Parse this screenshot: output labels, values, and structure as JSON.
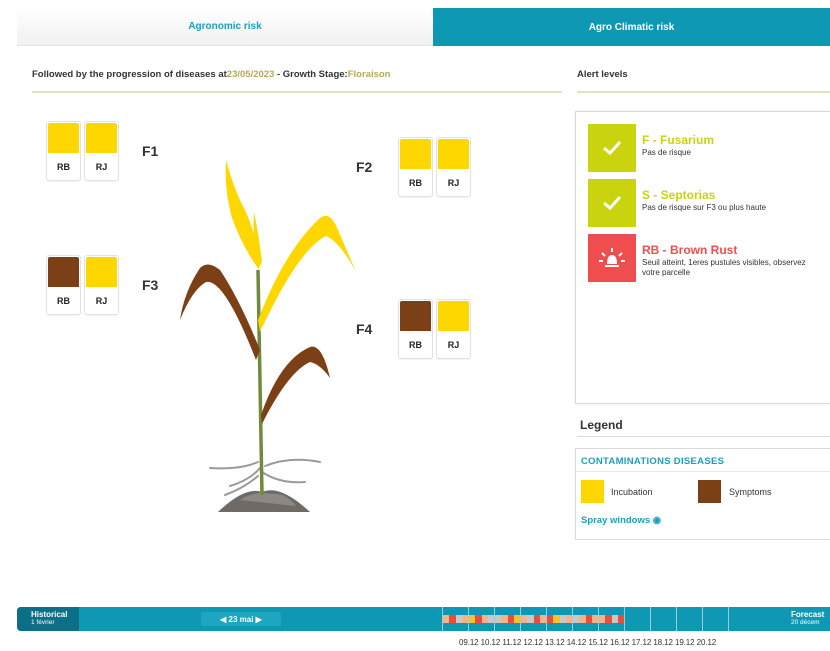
{
  "tabs": {
    "agronomic": "Agronomic risk",
    "climatic": "Agro Climatic risk"
  },
  "headline": {
    "prefix": "Followed by the progression of diseases at",
    "date": "23/05/2023",
    "middle": " - Growth Stage:",
    "stage": "Floraison"
  },
  "alert_title": "Alert levels",
  "leaves": [
    {
      "label": "F1",
      "cards": [
        {
          "code": "RB",
          "color": "#ffd700"
        },
        {
          "code": "RJ",
          "color": "#ffd700"
        }
      ]
    },
    {
      "label": "F2",
      "cards": [
        {
          "code": "RB",
          "color": "#ffd700"
        },
        {
          "code": "RJ",
          "color": "#ffd700"
        }
      ]
    },
    {
      "label": "F3",
      "cards": [
        {
          "code": "RB",
          "color": "#7b4016"
        },
        {
          "code": "RJ",
          "color": "#ffd700"
        }
      ]
    },
    {
      "label": "F4",
      "cards": [
        {
          "code": "RB",
          "color": "#7b4016"
        },
        {
          "code": "RJ",
          "color": "#ffd700"
        }
      ]
    }
  ],
  "alerts": [
    {
      "name": "F - Fusarium",
      "desc": "Pas de risque",
      "icon": "check-icon",
      "color": "#c9d40f",
      "text_color": "#c9d40f"
    },
    {
      "name": "S - Septorias",
      "desc": "Pas de risque sur F3 ou plus haute",
      "icon": "check-icon",
      "color": "#c9d40f",
      "text_color": "#c9d40f"
    },
    {
      "name": "RB - Brown Rust",
      "desc": "Seuil atteint, 1eres pustules visibles, observez votre parcelle",
      "icon": "alarm-icon",
      "color": "#f04e4e",
      "text_color": "#f04e4e"
    }
  ],
  "legend": {
    "title": "Legend",
    "contamination_title": "CONTAMINATIONS DISEASES",
    "incubation": "Incubation",
    "incubation_color": "#ffd700",
    "symptoms": "Symptoms",
    "symptoms_color": "#7b4016",
    "spray": "Spray windows"
  },
  "timeline": {
    "historical": "Historical",
    "historical_date": "1 février",
    "current": "23 mai",
    "forecast": "Forecast",
    "forecast_date": "20 décem",
    "dates": [
      "09.12",
      "10.12",
      "11.12",
      "12.12",
      "13.12",
      "14.12",
      "15.12",
      "16.12",
      "17.12",
      "18.12",
      "19.12",
      "20.12"
    ]
  },
  "colors": {
    "accent": "#0f98b3",
    "healthy": "#c9d40f",
    "danger": "#f04e4e"
  }
}
